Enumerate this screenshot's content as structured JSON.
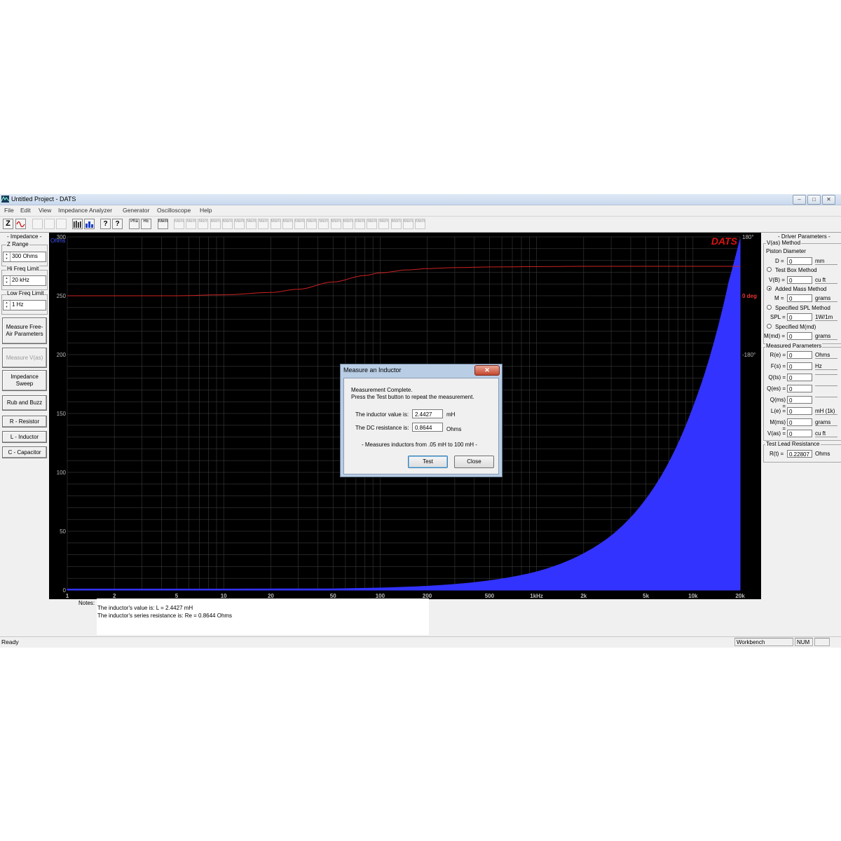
{
  "window": {
    "title": "Untitled Project - DATS",
    "buttons": [
      "–",
      "□",
      "✕"
    ]
  },
  "menu": [
    "File",
    "Edit",
    "View",
    "Impedance Analyzer",
    "Generator",
    "Oscilloscope",
    "Help"
  ],
  "toolbar": {
    "z_label": "Z",
    "mem_labels": [
      "Mem",
      "Mem",
      "Mem",
      "Mem",
      "Mem",
      "Mem",
      "Mem",
      "Mem",
      "Mem",
      "Mem",
      "Mem",
      "Mem",
      "Mem",
      "Mem",
      "Mem",
      "Mem",
      "Mem",
      "Mem",
      "Mem",
      "Mem",
      "Mem"
    ],
    "misc_labels": [
      "Pha",
      "RE",
      "Mem"
    ]
  },
  "left_panel": {
    "impedance_label": "- Impedance -",
    "z_range_label": "Z Range",
    "z_range_value": "300 Ohms",
    "hi_freq_label": "Hi Freq Limit",
    "hi_freq_value": "20 kHz",
    "low_freq_label": "Low Freq Limit",
    "low_freq_value": "1 Hz",
    "buttons": {
      "measure_free_air": "Measure Free-Air Parameters",
      "measure_vas": "Measure V(as)",
      "impedance_sweep": "Impedance Sweep",
      "rub_buzz": "Rub and Buzz",
      "resistor": "R - Resistor",
      "inductor": "L - Inductor",
      "capacitor": "C - Capacitor"
    }
  },
  "chart_data": {
    "type": "area",
    "brand": "DATS",
    "y_unit_label": "Ohms",
    "y_ticks": [
      "300",
      "250",
      "200",
      "150",
      "100",
      "50",
      "0"
    ],
    "ylim": [
      0,
      300
    ],
    "x_ticks": [
      "1",
      "2",
      "5",
      "10",
      "20",
      "50",
      "100",
      "200",
      "500",
      "1kHz",
      "2k",
      "5k",
      "10k",
      "20k"
    ],
    "x_tick_values": [
      1,
      2,
      5,
      10,
      20,
      50,
      100,
      200,
      500,
      1000,
      2000,
      5000,
      10000,
      20000
    ],
    "xlim": [
      1,
      20000
    ],
    "x_scale": "log",
    "right_axis_ticks": [
      "180°",
      "0 deg",
      "-180°"
    ],
    "right_axis_values": [
      180,
      0,
      -180
    ],
    "grid": true,
    "series": [
      {
        "color": "#3333ff",
        "axis": "left",
        "x": [
          1,
          10,
          50,
          100,
          200,
          500,
          1000,
          2000,
          3000,
          5000,
          7000,
          10000,
          12000,
          15000,
          17000,
          20000
        ],
        "y": [
          0.87,
          0.89,
          1.1,
          1.8,
          3.3,
          8.0,
          15.5,
          31,
          46,
          77,
          108,
          155,
          185,
          231,
          262,
          298
        ]
      },
      {
        "color": "#cc2222",
        "axis": "right",
        "x": [
          1,
          5,
          10,
          20,
          30,
          50,
          80,
          100,
          150,
          200,
          300,
          500,
          1000,
          2000,
          5000,
          10000,
          20000
        ],
        "y": [
          0,
          0,
          3,
          10,
          20,
          42,
          62,
          70,
          79,
          83,
          86,
          88,
          89,
          90,
          90,
          90,
          90
        ]
      }
    ],
    "colors": {
      "background": "#000000",
      "grid": "#3a3a3a",
      "impedance": "#3333ff",
      "phase": "#cc2222",
      "brand": "#dd1111"
    }
  },
  "right_panel": {
    "driver_params_title": "- Driver Parameters -",
    "vas_method_label": "V(as) Method",
    "piston_label": "Piston Diameter",
    "d_label": "D =",
    "d_value": "0",
    "d_unit": "mm",
    "test_box_label": "Test Box Method",
    "vb_label": "V(B) =",
    "vb_value": "0",
    "vb_unit": "cu ft",
    "added_mass_label": "Added Mass Method",
    "m_label": "M =",
    "m_value": "0",
    "m_unit": "grams",
    "spl_method_label": "Specified SPL Method",
    "spl_label": "SPL =",
    "spl_value": "0",
    "spl_unit": "1W/1m",
    "mmd_method_label": "Specified M(md)",
    "mmd_label": "M(md) =",
    "mmd_value": "0",
    "mmd_unit": "grams",
    "measured_title": "Measured Parameters",
    "measured": [
      {
        "label": "R(e) =",
        "value": "0",
        "unit": "Ohms"
      },
      {
        "label": "F(s) =",
        "value": "0",
        "unit": "Hz"
      },
      {
        "label": "Q(ts) =",
        "value": "0",
        "unit": ""
      },
      {
        "label": "Q(es) =",
        "value": "0",
        "unit": ""
      },
      {
        "label": "Q(ms) =",
        "value": "0",
        "unit": ""
      },
      {
        "label": "L(e) =",
        "value": "0",
        "unit": "mH (1k)"
      },
      {
        "label": "M(ms) =",
        "value": "0",
        "unit": "grams"
      },
      {
        "label": "V(as) =",
        "value": "0",
        "unit": "cu ft"
      }
    ],
    "test_lead_title": "Test Lead Resistance",
    "rt_label": "R(t) =",
    "rt_value": "0.22807",
    "rt_unit": "Ohms"
  },
  "notes": {
    "label": "Notes:",
    "line1": "The inductor's value is:    L = 2.4427 mH",
    "line2": "The inductor's series resistance is:    Re = 0.8644 Ohms"
  },
  "status": {
    "ready": "Ready",
    "workbench": "Workbench",
    "num": "NUM"
  },
  "dialog": {
    "title": "Measure an Inductor",
    "close_glyph": "✕",
    "message1": "Measurement Complete.",
    "message2": "Press the Test button to repeat the measurement.",
    "inductor_label": "The inductor value is:",
    "inductor_value": "2.4427",
    "inductor_unit": "mH",
    "dc_label": "The DC resistance is:",
    "dc_value": "0.8644",
    "dc_unit": "Ohms",
    "range_note": "- Measures inductors from .05 mH to 100 mH -",
    "test_button": "Test",
    "close_button": "Close"
  }
}
